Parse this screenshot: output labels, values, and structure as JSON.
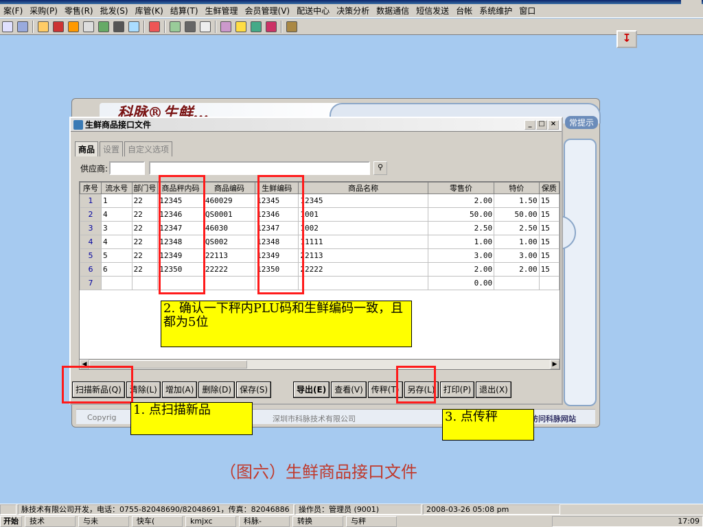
{
  "menu": [
    "案(F)",
    "采购(P)",
    "零售(R)",
    "批发(S)",
    "库管(K)",
    "结算(T)",
    "生鲜管理",
    "会员管理(V)",
    "配送中心",
    "决策分析",
    "数据通信",
    "短信发送",
    "台帐",
    "系统维护",
    "窗口"
  ],
  "background_window": {
    "banner": "科脉®生鲜...",
    "notice_label": "常提示",
    "copyright": "Copyrig",
    "company": "深圳市科脉技术有限公司",
    "site_link": "访问科脉网站"
  },
  "dialog": {
    "title": "生鲜商品接口文件",
    "tabs": [
      "商品",
      "设置",
      "自定义选项"
    ],
    "supplier_label": "供应商:"
  },
  "table": {
    "headers": [
      "序号",
      "流水号",
      "部门号",
      "商品秤内码",
      "商品编码",
      "生鲜编码",
      "商品名称",
      "零售价",
      "特价",
      "保质"
    ],
    "rows": [
      [
        "1",
        "1",
        "22",
        "12345",
        "460029",
        "12345",
        "12345",
        "2.00",
        "1.50",
        "15"
      ],
      [
        "2",
        "4",
        "22",
        "12346",
        "QS0001",
        "12346",
        "1001",
        "50.00",
        "50.00",
        "15"
      ],
      [
        "3",
        "3",
        "22",
        "12347",
        "46030",
        "12347",
        "1002",
        "2.50",
        "2.50",
        "15"
      ],
      [
        "4",
        "4",
        "22",
        "12348",
        "QS002",
        "12348",
        "11111",
        "1.00",
        "1.00",
        "15"
      ],
      [
        "5",
        "5",
        "22",
        "12349",
        "22113",
        "12349",
        "22113",
        "3.00",
        "3.00",
        "15"
      ],
      [
        "6",
        "6",
        "22",
        "12350",
        "22222",
        "12350",
        "22222",
        "2.00",
        "2.00",
        "15"
      ],
      [
        "7",
        "",
        "",
        "",
        "",
        "",
        "",
        "0.00",
        "",
        ""
      ]
    ]
  },
  "buttons": [
    "扫描新品(Q)",
    "清除(L)",
    "增加(A)",
    "删除(D)",
    "保存(S)",
    "导出(E)",
    "查看(V)",
    "传秤(T)",
    "另存(L)",
    "打印(P)",
    "退出(X)"
  ],
  "callouts": {
    "step1": "1. 点扫描新品",
    "step2": "2. 确认一下秤内PLU码和生鲜编码一致，且都为5位",
    "step3": "3. 点传秤"
  },
  "caption": "（图六）生鲜商品接口文件",
  "status": {
    "developer": "脉技术有限公司开发，电话：0755-82048690/82048691，传真：82046886",
    "operator": "操作员：管理员 (9001)",
    "datetime": "2008-03-26 05:08 pm"
  },
  "taskbar": {
    "start": "开始",
    "tasks": [
      "技术",
      "与未",
      "快车(",
      "kmjxc",
      "科脉-",
      "转换",
      "与秤"
    ],
    "clock": "17:09"
  },
  "colors": {
    "desktop": "#a6caf0",
    "callout": "#ffff00",
    "highlight": "#ff1a1a",
    "caption": "#c0392b"
  }
}
